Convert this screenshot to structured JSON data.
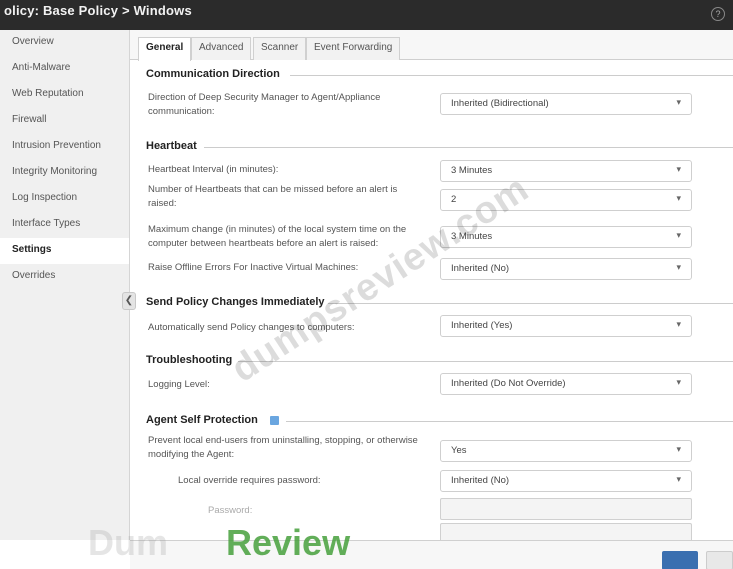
{
  "window": {
    "title": "olicy: Base Policy > Windows"
  },
  "sidebar": {
    "items": [
      {
        "label": "Overview"
      },
      {
        "label": "Anti-Malware"
      },
      {
        "label": "Web Reputation"
      },
      {
        "label": "Firewall"
      },
      {
        "label": "Intrusion Prevention"
      },
      {
        "label": "Integrity Monitoring"
      },
      {
        "label": "Log Inspection"
      },
      {
        "label": "Interface Types"
      },
      {
        "label": "Settings"
      },
      {
        "label": "Overrides"
      }
    ],
    "active_index": 8
  },
  "tabs": [
    {
      "label": "General"
    },
    {
      "label": "Advanced"
    },
    {
      "label": "Scanner"
    },
    {
      "label": "Event Forwarding"
    }
  ],
  "sections": {
    "communication": {
      "title": "Communication Direction",
      "direction_label": "Direction of Deep Security Manager to Agent/Appliance communication:",
      "direction_value": "Inherited (Bidirectional)"
    },
    "heartbeat": {
      "title": "Heartbeat",
      "interval_label": "Heartbeat Interval (in minutes):",
      "interval_value": "3 Minutes",
      "missed_label": "Number of Heartbeats that can be missed before an alert is raised:",
      "missed_value": "2",
      "clock_label": "Maximum change (in minutes) of the local system time on the computer between heartbeats before an alert is raised:",
      "clock_value": "3 Minutes",
      "offline_label": "Raise Offline Errors For Inactive Virtual Machines:",
      "offline_value": "Inherited (No)"
    },
    "send_policy": {
      "title": "Send Policy Changes Immediately",
      "auto_label": "Automatically send Policy changes to computers:",
      "auto_value": "Inherited (Yes)"
    },
    "troubleshooting": {
      "title": "Troubleshooting",
      "logging_label": "Logging Level:",
      "logging_value": "Inherited (Do Not Override)"
    },
    "self_protection": {
      "title": "Agent Self Protection",
      "prevent_label": "Prevent local end-users from uninstalling, stopping, or otherwise modifying the Agent:",
      "prevent_value": "Yes",
      "override_label": "Local override requires password:",
      "override_value": "Inherited (No)",
      "password_label": "Password:"
    }
  },
  "watermarks": {
    "diagonal": "dumpsreview.com",
    "bottom_grey": "Dum",
    "bottom_green": "Review"
  },
  "colors": {
    "titlebar": "#2b2b2b",
    "primary_button": "#3a6fb0",
    "info_icon": "#6aa6e0",
    "watermark_green": "#46a03c"
  }
}
